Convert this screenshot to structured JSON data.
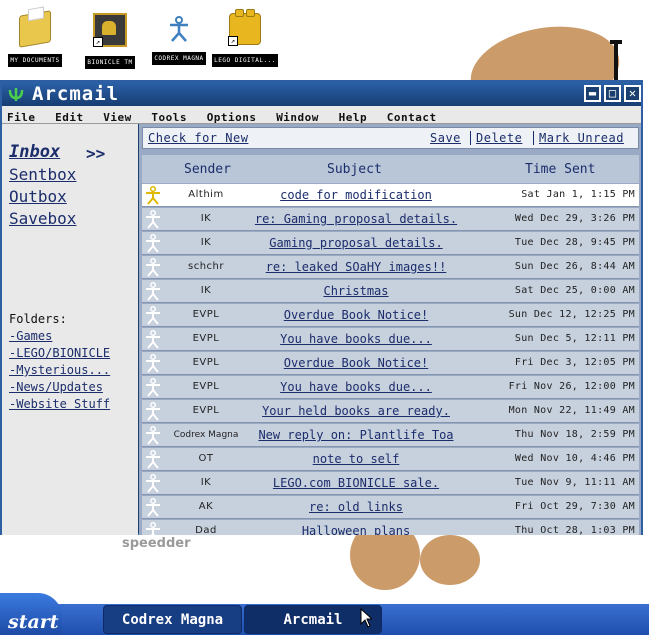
{
  "desktop": {
    "icons": [
      {
        "label": "MY DOCUMENTS",
        "icon": "folder-icon"
      },
      {
        "label": "BIONICLE TM",
        "icon": "bionicle-icon"
      },
      {
        "label": "CODREX MAGNA",
        "icon": "codrex-icon"
      },
      {
        "label": "LEGO DIGITAL...",
        "icon": "lego-icon"
      }
    ],
    "scribble": "speedder"
  },
  "window": {
    "title": "Arcmail",
    "controls": {
      "minimize": "▬",
      "maximize": "□",
      "close": "✕"
    }
  },
  "menu": [
    "File",
    "Edit",
    "View",
    "Tools",
    "Options",
    "Window",
    "Help",
    "Contact"
  ],
  "sidebar": {
    "nav": [
      "Inbox",
      "Sentbox",
      "Outbox",
      "Savebox"
    ],
    "active_marker": ">>",
    "folders_label": "Folders:",
    "folders": [
      "-Games",
      "-LEGO/BIONICLE",
      "-Mysterious...",
      "-News/Updates",
      "-Website Stuff"
    ]
  },
  "toolbar": {
    "check": "Check for New",
    "save": "Save",
    "delete": "Delete",
    "mark_unread": "Mark Unread"
  },
  "columns": {
    "sender": "Sender",
    "subject": "Subject",
    "time": "Time Sent"
  },
  "messages": [
    {
      "sender": "Althim",
      "subject": "code for modification",
      "time": "Sat Jan 1, 1:15 PM",
      "unread": true
    },
    {
      "sender": "IK",
      "subject": "re: Gaming proposal details.",
      "time": "Wed Dec 29, 3:26 PM",
      "unread": false
    },
    {
      "sender": "IK",
      "subject": "Gaming proposal details.",
      "time": "Tue Dec 28, 9:45 PM",
      "unread": false
    },
    {
      "sender": "schchr",
      "subject": "re: leaked SOaHY images!!",
      "time": "Sun Dec 26, 8:44 AM",
      "unread": false
    },
    {
      "sender": "IK",
      "subject": "Christmas",
      "time": "Sat Dec 25, 0:00 AM",
      "unread": false
    },
    {
      "sender": "EVPL",
      "subject": "Overdue Book Notice!",
      "time": "Sun Dec 12, 12:25 PM",
      "unread": false
    },
    {
      "sender": "EVPL",
      "subject": "You have books due...",
      "time": "Sun Dec 5, 12:11 PM",
      "unread": false
    },
    {
      "sender": "EVPL",
      "subject": "Overdue Book Notice!",
      "time": "Fri Dec 3, 12:05 PM",
      "unread": false
    },
    {
      "sender": "EVPL",
      "subject": "You have books due...",
      "time": "Fri Nov 26, 12:00 PM",
      "unread": false
    },
    {
      "sender": "EVPL",
      "subject": "Your held books are ready.",
      "time": "Mon Nov 22, 11:49 AM",
      "unread": false
    },
    {
      "sender": "Codrex Magna",
      "subject": "New reply on: Plantlife Toa",
      "time": "Thu Nov 18, 2:59 PM",
      "unread": false
    },
    {
      "sender": "OT",
      "subject": "note to self",
      "time": "Wed Nov 10, 4:46 PM",
      "unread": false
    },
    {
      "sender": "IK",
      "subject": "LEGO.com BIONICLE sale.",
      "time": "Tue Nov 9, 11:11 AM",
      "unread": false
    },
    {
      "sender": "AK",
      "subject": "re: old links",
      "time": "Fri Oct 29, 7:30 AM",
      "unread": false
    },
    {
      "sender": "Dad",
      "subject": "Halloween plans",
      "time": "Thu Oct 28, 1:03 PM",
      "unread": false
    }
  ],
  "taskbar": {
    "start": "start",
    "tasks": [
      "Codrex Magna",
      "Arcmail"
    ],
    "active_task": "Arcmail"
  }
}
